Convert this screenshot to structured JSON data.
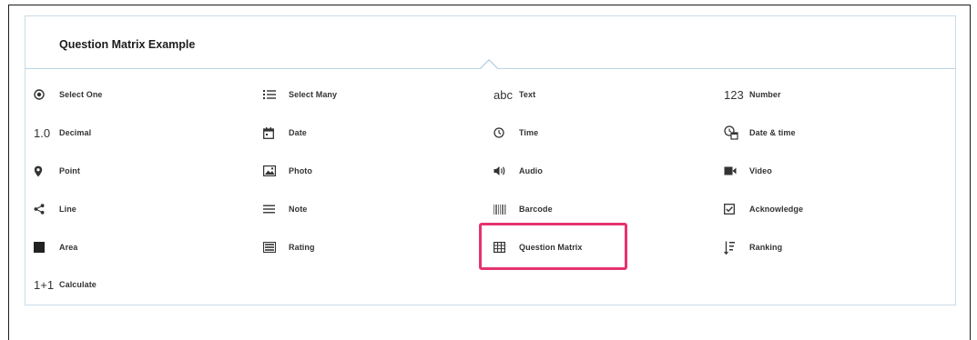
{
  "dialog": {
    "title": "Question Matrix Example",
    "close_symbol": "×"
  },
  "question_types": [
    {
      "label": "Select One",
      "icon": "radio-icon"
    },
    {
      "label": "Select Many",
      "icon": "list-icon"
    },
    {
      "label": "Text",
      "icon": "abc",
      "icon_text": "abc"
    },
    {
      "label": "Number",
      "icon": "123",
      "icon_text": "123"
    },
    {
      "label": "Decimal",
      "icon": "1.0",
      "icon_text": "1.0"
    },
    {
      "label": "Date",
      "icon": "calendar-icon"
    },
    {
      "label": "Time",
      "icon": "clock-icon"
    },
    {
      "label": "Date & time",
      "icon": "calendar-clock-icon"
    },
    {
      "label": "Point",
      "icon": "map-pin-icon"
    },
    {
      "label": "Photo",
      "icon": "photo-icon"
    },
    {
      "label": "Audio",
      "icon": "audio-icon"
    },
    {
      "label": "Video",
      "icon": "video-icon"
    },
    {
      "label": "Line",
      "icon": "share-icon"
    },
    {
      "label": "Note",
      "icon": "note-icon"
    },
    {
      "label": "Barcode",
      "icon": "barcode-icon"
    },
    {
      "label": "Acknowledge",
      "icon": "checkbox-icon"
    },
    {
      "label": "Area",
      "icon": "area-icon"
    },
    {
      "label": "Rating",
      "icon": "rating-icon"
    },
    {
      "label": "Question Matrix",
      "icon": "table-icon"
    },
    {
      "label": "Ranking",
      "icon": "ranking-icon"
    },
    {
      "label": "Calculate",
      "icon": "1+1",
      "icon_text": "1+1"
    }
  ],
  "colors": {
    "highlight": "#e5336f",
    "panel_border": "#c9dbe8"
  }
}
